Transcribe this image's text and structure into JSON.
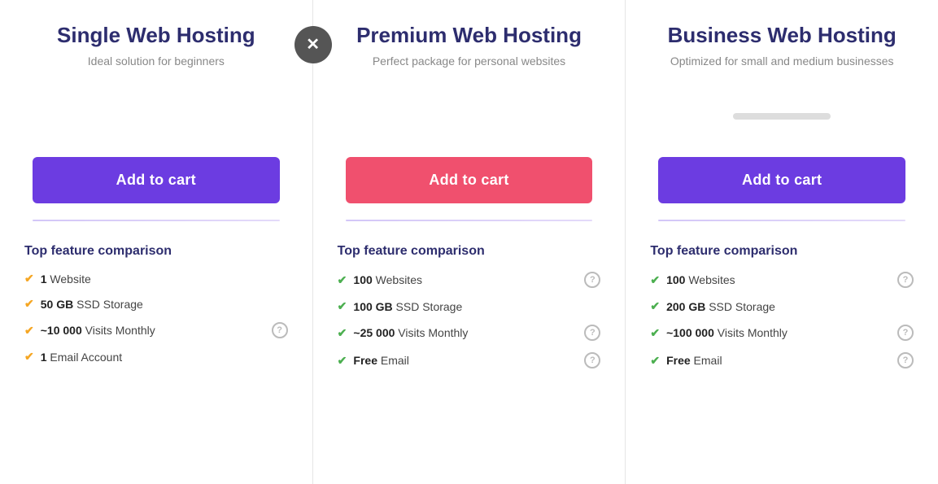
{
  "plans": [
    {
      "id": "single",
      "title": "Single Web Hosting",
      "subtitle": "Ideal solution for beginners",
      "btn_label": "Add to cart",
      "btn_style": "purple",
      "features_title": "Top feature comparison",
      "features": [
        {
          "num": "1",
          "text": " Website",
          "has_info": false
        },
        {
          "num": "50 GB",
          "text": " SSD Storage",
          "has_info": false
        },
        {
          "num": "~10 000",
          "text": " Visits Monthly",
          "has_info": true
        },
        {
          "num": "1",
          "text": " Email Account",
          "has_info": false
        }
      ]
    },
    {
      "id": "premium",
      "title": "Premium Web Hosting",
      "subtitle": "Perfect package for personal websites",
      "btn_label": "Add to cart",
      "btn_style": "pink",
      "features_title": "Top feature comparison",
      "features": [
        {
          "num": "100",
          "text": " Websites",
          "has_info": true
        },
        {
          "num": "100 GB",
          "text": " SSD Storage",
          "has_info": false
        },
        {
          "num": "~25 000",
          "text": " Visits Monthly",
          "has_info": true
        },
        {
          "num": "Free",
          "text": " Email",
          "has_info": true
        }
      ]
    },
    {
      "id": "business",
      "title": "Business Web Hosting",
      "subtitle": "Optimized for small and medium businesses",
      "btn_label": "Add to cart",
      "btn_style": "purple",
      "features_title": "Top feature comparison",
      "features": [
        {
          "num": "100",
          "text": " Websites",
          "has_info": true
        },
        {
          "num": "200 GB",
          "text": " SSD Storage",
          "has_info": false
        },
        {
          "num": "~100 000",
          "text": " Visits Monthly",
          "has_info": true
        },
        {
          "num": "Free",
          "text": " Email",
          "has_info": true
        }
      ]
    }
  ],
  "close_icon": "✕"
}
